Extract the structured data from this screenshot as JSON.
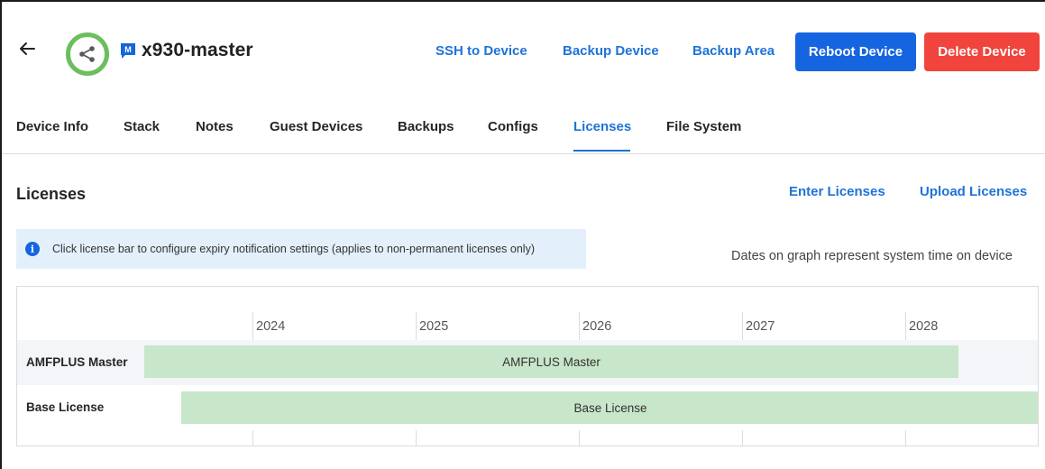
{
  "header": {
    "device_name": "x930-master",
    "badge_letter": "M",
    "links": [
      "SSH to Device",
      "Backup Device",
      "Backup Area"
    ],
    "reboot_label": "Reboot Device",
    "delete_label": "Delete Device"
  },
  "colors": {
    "accent": "#1e73d8",
    "primary_button": "#1565e0",
    "danger_button": "#f0443c",
    "status_ring": "#6bbf5d",
    "license_bar": "#c8e6c9",
    "info_box": "#e3f0fb"
  },
  "icons": {
    "back": "arrow-left-icon",
    "status": "share-icon",
    "badge": "bookmark-m-icon",
    "info": "info-icon"
  },
  "tabs": [
    {
      "label": "Device Info",
      "active": false
    },
    {
      "label": "Stack",
      "active": false
    },
    {
      "label": "Notes",
      "active": false
    },
    {
      "label": "Guest Devices",
      "active": false
    },
    {
      "label": "Backups",
      "active": false
    },
    {
      "label": "Configs",
      "active": false
    },
    {
      "label": "Licenses",
      "active": true
    },
    {
      "label": "File System",
      "active": false
    }
  ],
  "licenses": {
    "title": "Licenses",
    "enter_label": "Enter Licenses",
    "upload_label": "Upload Licenses",
    "info_text": "Click license bar to configure expiry notification settings (applies to non-permanent licenses only)",
    "dates_note": "Dates on graph represent system time on device"
  },
  "timeline": {
    "years": [
      "2024",
      "2025",
      "2026",
      "2027",
      "2028"
    ],
    "rows": [
      {
        "label": "AMFPLUS Master",
        "bar_label": "AMFPLUS Master"
      },
      {
        "label": "Base License",
        "bar_label": "Base License"
      }
    ]
  }
}
